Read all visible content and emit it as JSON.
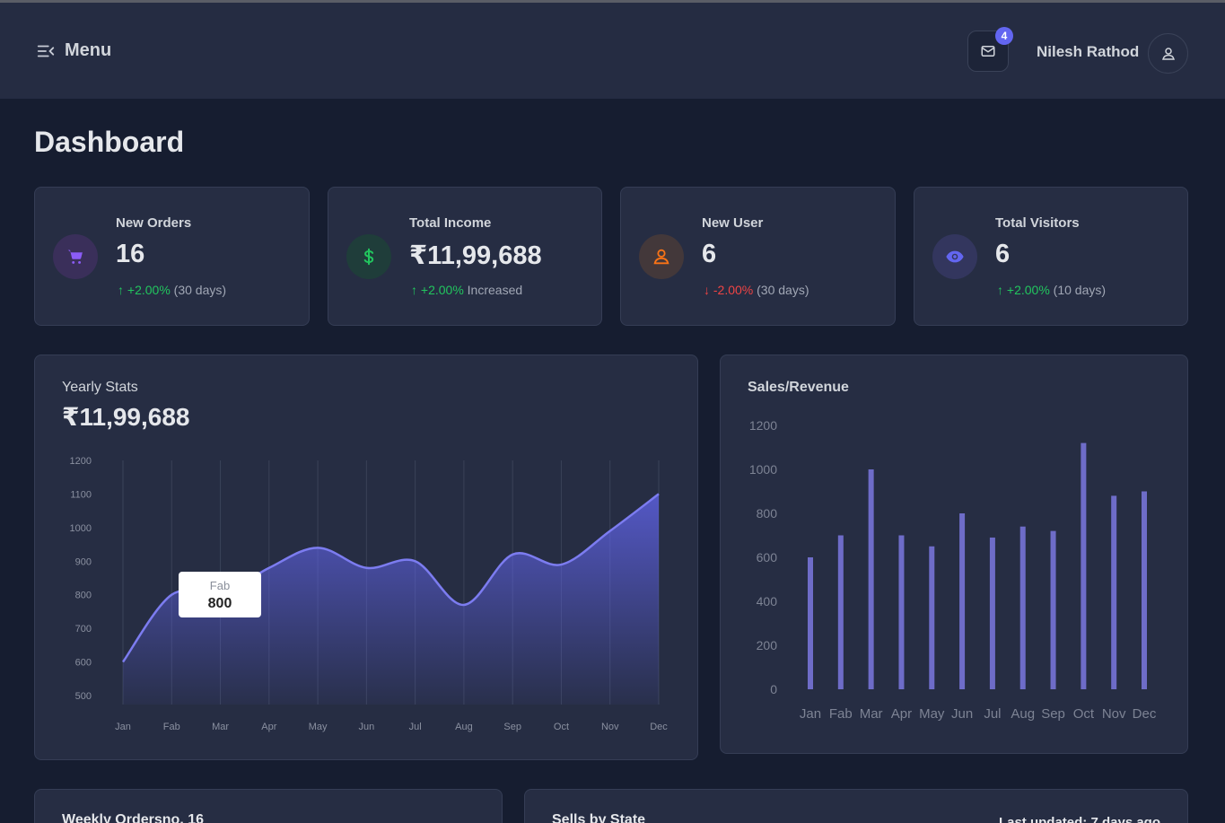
{
  "header": {
    "menu_label": "Menu",
    "notification_count": "4",
    "user_name": "Nilesh Rathod"
  },
  "page_title": "Dashboard",
  "stats": [
    {
      "label": "New Orders",
      "value": "16",
      "change": "+2.00%",
      "period": "(30 days)",
      "direction": "up",
      "icon": "cart-icon",
      "color": "#8b5cf6"
    },
    {
      "label": "Total Income",
      "value": "₹11,99,688",
      "change": "+2.00%",
      "period": "Increased",
      "direction": "up",
      "icon": "dollar-icon",
      "color": "#22c55e"
    },
    {
      "label": "New User",
      "value": "6",
      "change": "-2.00%",
      "period": "(30 days)",
      "direction": "down",
      "icon": "user-icon",
      "color": "#f97316"
    },
    {
      "label": "Total Visitors",
      "value": "6",
      "change": "+2.00%",
      "period": "(10 days)",
      "direction": "up",
      "icon": "eye-icon",
      "color": "#6366f1"
    }
  ],
  "yearly": {
    "title": "Yearly Stats",
    "total": "₹11,99,688",
    "tooltip": {
      "label": "Fab",
      "value": "800"
    }
  },
  "sales": {
    "title": "Sales/Revenue"
  },
  "bottom": {
    "weekly_title": "Weekly Ordersno. 16",
    "state_title": "Sells by State",
    "state_updated": "Last updated: 7 days ago"
  },
  "colors": {
    "accent": "#6366f1",
    "bar": "#6e6cc8",
    "line": "#7c7cf0"
  },
  "chart_data": [
    {
      "type": "area",
      "title": "Yearly Stats",
      "categories": [
        "Jan",
        "Fab",
        "Mar",
        "Apr",
        "May",
        "Jun",
        "Jul",
        "Aug",
        "Sep",
        "Oct",
        "Nov",
        "Dec"
      ],
      "values": [
        600,
        800,
        800,
        880,
        940,
        880,
        900,
        770,
        920,
        890,
        990,
        1100
      ],
      "ylim": [
        500,
        1200
      ],
      "yticks": [
        500,
        600,
        700,
        800,
        900,
        1000,
        1100,
        1200
      ],
      "grid": "vertical"
    },
    {
      "type": "bar",
      "title": "Sales/Revenue",
      "categories": [
        "Jan",
        "Fab",
        "Mar",
        "Apr",
        "May",
        "Jun",
        "Jul",
        "Aug",
        "Sep",
        "Oct",
        "Nov",
        "Dec"
      ],
      "values": [
        600,
        700,
        1000,
        700,
        650,
        800,
        690,
        740,
        720,
        1120,
        880,
        900
      ],
      "ylim": [
        0,
        1200
      ],
      "yticks": [
        0,
        200,
        400,
        600,
        800,
        1000,
        1200
      ]
    }
  ]
}
